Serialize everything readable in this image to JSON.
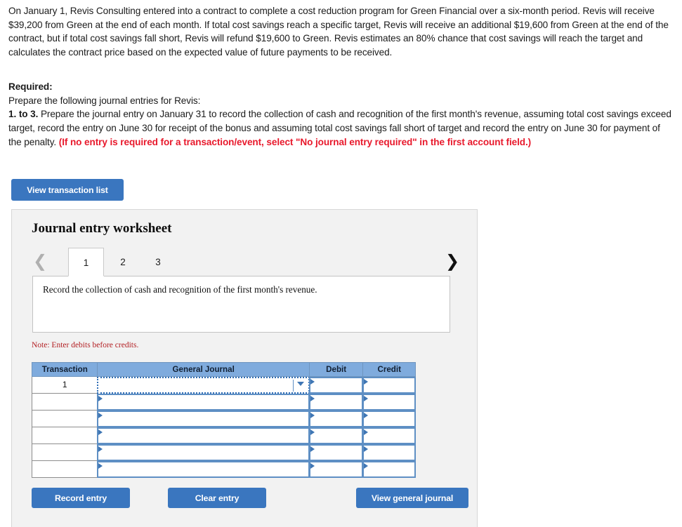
{
  "problem": {
    "paragraph": "On January 1, Revis Consulting entered into a contract to complete a cost reduction program for Green Financial over a six-month period. Revis will receive $39,200 from Green at the end of each month. If total cost savings reach a specific target, Revis will receive an additional $19,600 from Green at the end of the contract, but if total cost savings fall short, Revis will refund $19,600 to Green. Revis estimates an 80% chance that cost savings will reach the target and calculates the contract price based on the expected value of future payments to be received."
  },
  "required": {
    "heading": "Required:",
    "line2": "Prepare the following journal entries for Revis:",
    "item_label": "1. to 3.",
    "item_text": " Prepare the journal entry on January 31 to record the collection of cash and recognition of the first month's revenue, assuming total cost savings exceed target, record the entry on June 30 for receipt of the bonus and assuming total cost savings fall short of target and record the entry on June 30 for payment of the penalty. ",
    "parenthetical": "(If no entry is required for a transaction/event, select \"No journal entry required\" in the first account field.)"
  },
  "toolbar": {
    "view_transaction_list_label": "View transaction list"
  },
  "worksheet": {
    "title": "Journal entry worksheet",
    "prev_icon": "chevron-left-icon",
    "next_icon": "chevron-right-icon",
    "tabs": [
      {
        "label": "1",
        "active": true
      },
      {
        "label": "2",
        "active": false
      },
      {
        "label": "3",
        "active": false
      }
    ],
    "description": "Record the collection of cash and recognition of the first month's revenue.",
    "note": "Note: Enter debits before credits.",
    "table": {
      "headers": [
        "Transaction",
        "General Journal",
        "Debit",
        "Credit"
      ],
      "rows": [
        {
          "transaction": "1",
          "general_journal": "",
          "debit": "",
          "credit": ""
        },
        {
          "transaction": "",
          "general_journal": "",
          "debit": "",
          "credit": ""
        },
        {
          "transaction": "",
          "general_journal": "",
          "debit": "",
          "credit": ""
        },
        {
          "transaction": "",
          "general_journal": "",
          "debit": "",
          "credit": ""
        },
        {
          "transaction": "",
          "general_journal": "",
          "debit": "",
          "credit": ""
        },
        {
          "transaction": "",
          "general_journal": "",
          "debit": "",
          "credit": ""
        }
      ]
    },
    "buttons": {
      "record_entry": "Record entry",
      "clear_entry": "Clear entry",
      "view_general_journal": "View general journal"
    }
  },
  "colors": {
    "button_blue": "#3a76bf",
    "table_header_blue": "#7fabdd",
    "input_border_blue": "#5e8fc4",
    "note_red": "#b32024",
    "required_red": "#e8192c",
    "panel_gray": "#f2f2f2"
  }
}
